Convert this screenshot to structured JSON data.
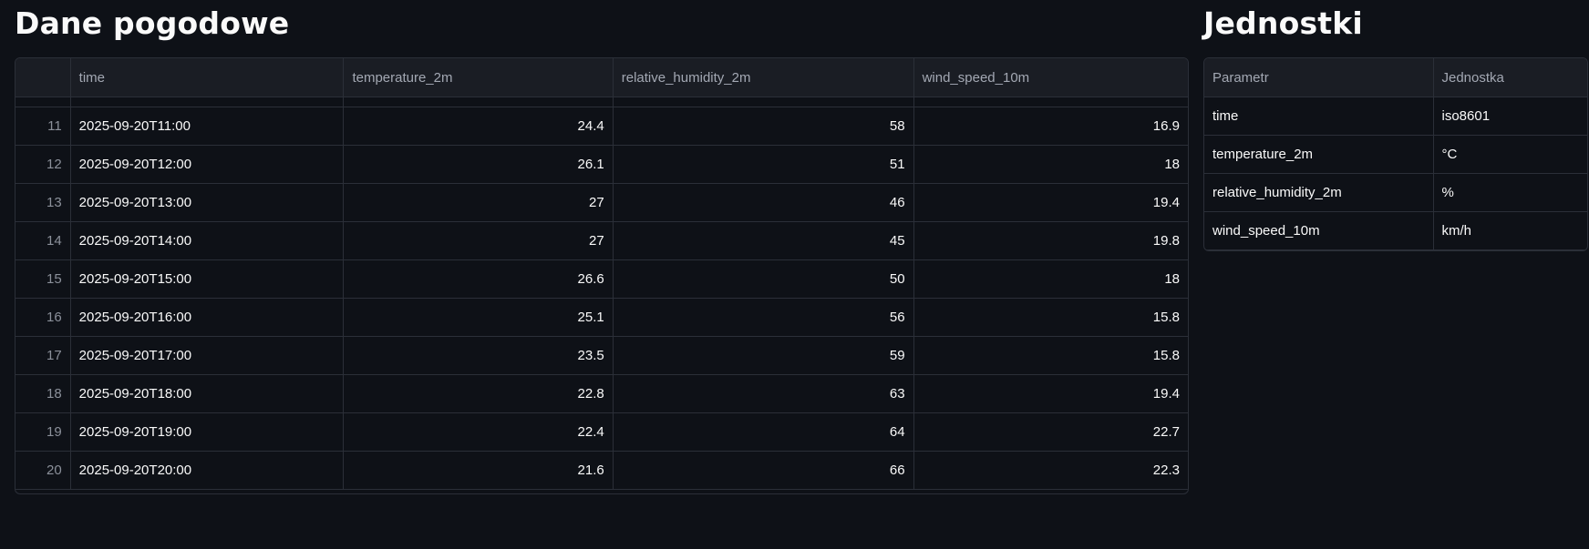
{
  "weather": {
    "title": "Dane pogodowe",
    "columns": [
      "",
      "time",
      "temperature_2m",
      "relative_humidity_2m",
      "wind_speed_10m"
    ],
    "rows": [
      {
        "idx": "11",
        "time": "2025-09-20T11:00",
        "temperature_2m": "24.4",
        "relative_humidity_2m": "58",
        "wind_speed_10m": "16.9"
      },
      {
        "idx": "12",
        "time": "2025-09-20T12:00",
        "temperature_2m": "26.1",
        "relative_humidity_2m": "51",
        "wind_speed_10m": "18"
      },
      {
        "idx": "13",
        "time": "2025-09-20T13:00",
        "temperature_2m": "27",
        "relative_humidity_2m": "46",
        "wind_speed_10m": "19.4"
      },
      {
        "idx": "14",
        "time": "2025-09-20T14:00",
        "temperature_2m": "27",
        "relative_humidity_2m": "45",
        "wind_speed_10m": "19.8"
      },
      {
        "idx": "15",
        "time": "2025-09-20T15:00",
        "temperature_2m": "26.6",
        "relative_humidity_2m": "50",
        "wind_speed_10m": "18"
      },
      {
        "idx": "16",
        "time": "2025-09-20T16:00",
        "temperature_2m": "25.1",
        "relative_humidity_2m": "56",
        "wind_speed_10m": "15.8"
      },
      {
        "idx": "17",
        "time": "2025-09-20T17:00",
        "temperature_2m": "23.5",
        "relative_humidity_2m": "59",
        "wind_speed_10m": "15.8"
      },
      {
        "idx": "18",
        "time": "2025-09-20T18:00",
        "temperature_2m": "22.8",
        "relative_humidity_2m": "63",
        "wind_speed_10m": "19.4"
      },
      {
        "idx": "19",
        "time": "2025-09-20T19:00",
        "temperature_2m": "22.4",
        "relative_humidity_2m": "64",
        "wind_speed_10m": "22.7"
      },
      {
        "idx": "20",
        "time": "2025-09-20T20:00",
        "temperature_2m": "21.6",
        "relative_humidity_2m": "66",
        "wind_speed_10m": "22.3"
      }
    ]
  },
  "units": {
    "title": "Jednostki",
    "columns": [
      "Parametr",
      "Jednostka"
    ],
    "rows": [
      {
        "param": "time",
        "unit": "iso8601"
      },
      {
        "param": "temperature_2m",
        "unit": "°C"
      },
      {
        "param": "relative_humidity_2m",
        "unit": "%"
      },
      {
        "param": "wind_speed_10m",
        "unit": "km/h"
      }
    ]
  },
  "colors": {
    "background": "#0e1117",
    "header_bg": "#1a1d24",
    "border": "#2b2f38",
    "text": "#fafafa",
    "muted_text": "#a3a8b3"
  }
}
